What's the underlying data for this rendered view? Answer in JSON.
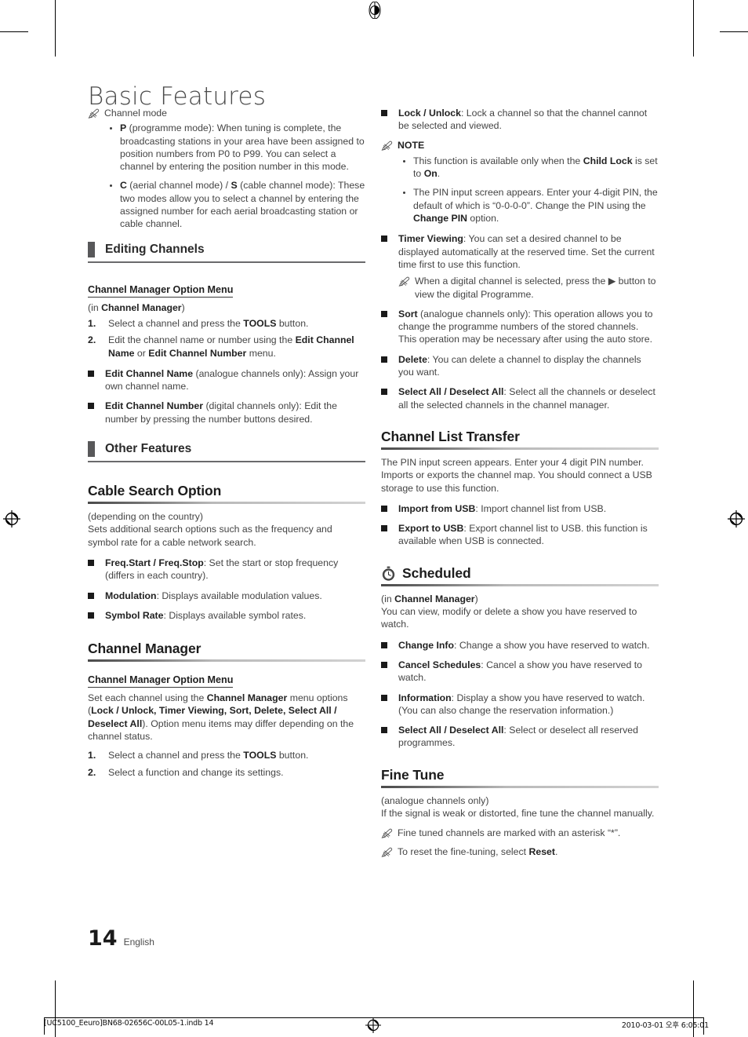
{
  "document": {
    "title": "Basic Features",
    "page_number": "14",
    "language": "English"
  },
  "footer": {
    "file": "[UC5100_Eeuro]BN68-02656C-00L05-1.indb   14",
    "datetime": "2010-03-01   오후 6:05:01"
  },
  "left_column": {
    "note_channel_mode": "Channel mode",
    "bullets": [
      {
        "bold": "P",
        "rest": " (programme mode): When tuning is complete, the broadcasting stations in your area have been assigned to position numbers from P0 to P99. You can select a channel by entering the position number in this mode."
      },
      {
        "bold": "C",
        "mid": " (aerial channel mode) / ",
        "bold2": "S",
        "rest": " (cable channel mode): These two modes allow you to select a channel by entering the assigned number for each aerial broadcasting station or cable channel."
      }
    ],
    "section_editing_channels": "Editing Channels",
    "cm_option_menu_heading": "Channel Manager Option Menu",
    "cm_option_menu_in_prefix": "(in ",
    "cm_option_menu_in_bold": "Channel Manager",
    "cm_option_menu_in_suffix": ")",
    "steps": [
      {
        "num": "1.",
        "text_a": "Select a channel and press the ",
        "bold": "TOOLS",
        "text_b": " button."
      },
      {
        "num": "2.",
        "text_a": "Edit the channel name or number using the ",
        "bold": "Edit Channel Name",
        "mid": " or ",
        "bold2": "Edit Channel Number",
        "text_b": " menu."
      }
    ],
    "edit_items": [
      {
        "bold": "Edit Channel Name",
        "rest": " (analogue channels only): Assign your own channel name."
      },
      {
        "bold": "Edit Channel Number",
        "rest": " (digital channels only): Edit the number by pressing the number buttons desired."
      }
    ],
    "section_other_features": "Other Features",
    "cable_search": {
      "heading": "Cable Search Option",
      "line1": "(depending on the country)",
      "line2": "Sets additional search options such as the frequency and symbol rate for a cable network search.",
      "items": [
        {
          "bold": "Freq.Start / Freq.Stop",
          "rest": ": Set the start or stop frequency (differs in each country)."
        },
        {
          "bold": "Modulation",
          "rest": ": Displays available modulation values."
        },
        {
          "bold": "Symbol Rate",
          "rest": ": Displays available symbol rates."
        }
      ]
    },
    "channel_manager": {
      "heading": "Channel Manager",
      "option_menu_heading": "Channel Manager Option Menu",
      "intro_a": "Set each channel using the ",
      "intro_bold1": "Channel Manager",
      "intro_b": " menu options (",
      "intro_bold2": "Lock / Unlock, Timer Viewing, Sort, Delete, Select All / Deselect All",
      "intro_c": "). Option menu items may differ depending on the channel status.",
      "steps": [
        {
          "num": "1.",
          "text_a": "Select a channel and press the ",
          "bold": "TOOLS",
          "text_b": " button."
        },
        {
          "num": "2.",
          "text_a": "Select a function and change its settings.",
          "bold": "",
          "text_b": ""
        }
      ]
    }
  },
  "right_column": {
    "lock_unlock": {
      "bold": "Lock / Unlock",
      "rest": ": Lock a channel so that the channel cannot be selected and viewed."
    },
    "note_label": "NOTE",
    "note_bullets": [
      {
        "a": "This function is available only when the ",
        "bold": "Child Lock",
        "b": " is set to ",
        "bold2": "On",
        "c": "."
      },
      {
        "a": "The PIN input screen appears. Enter your 4-digit PIN, the default of which is “0-0-0-0”. Change the PIN using the ",
        "bold": "Change PIN",
        "b": " option.",
        "bold2": "",
        "c": ""
      }
    ],
    "timer_viewing": {
      "bold": "Timer Viewing",
      "rest": ": You can set a desired channel to be displayed automatically at the reserved time. Set the current time first to use this function."
    },
    "timer_subnote": "When a digital channel is selected, press the ▶ button to view the digital Programme.",
    "sort": {
      "bold": "Sort",
      "rest": " (analogue channels only): This operation allows you to change the programme numbers of the stored channels. This operation may be necessary after using the auto store."
    },
    "delete": {
      "bold": "Delete",
      "rest": ": You can delete a channel to display the channels you want."
    },
    "select_all": {
      "bold": "Select All / Deselect All",
      "rest": ": Select all the channels or deselect all the selected channels in the channel manager."
    },
    "channel_list_transfer": {
      "heading": "Channel List Transfer",
      "intro": "The PIN input screen appears. Enter your 4 digit PIN number. Imports or exports the channel map. You should connect a USB storage to use this function.",
      "items": [
        {
          "bold": "Import from USB",
          "rest": ": Import channel list from USB."
        },
        {
          "bold": "Export to USB",
          "rest": ": Export channel list to USB. this function is available when USB is connected."
        }
      ]
    },
    "scheduled": {
      "heading": "Scheduled",
      "icon": "stopwatch-icon",
      "in_prefix": "(in ",
      "in_bold": "Channel Manager",
      "in_suffix": ")",
      "intro": "You can view, modify or delete a show you have reserved to watch.",
      "items": [
        {
          "bold": "Change Info",
          "rest": ": Change a show you have reserved to watch."
        },
        {
          "bold": "Cancel Schedules",
          "rest": ": Cancel a show you have reserved to watch."
        },
        {
          "bold": "Information",
          "rest": ": Display a show you have reserved to watch. (You can also change the reservation information.)"
        },
        {
          "bold": "Select All / Deselect All",
          "rest": ": Select or deselect all reserved programmes."
        }
      ]
    },
    "fine_tune": {
      "heading": "Fine Tune",
      "line1": "(analogue channels only)",
      "line2": "If the signal is weak or distorted, fine tune the channel manually.",
      "note1": "Fine tuned channels are marked with an asterisk “*”.",
      "note2_a": "To reset the fine-tuning, select ",
      "note2_bold": "Reset",
      "note2_b": "."
    }
  }
}
